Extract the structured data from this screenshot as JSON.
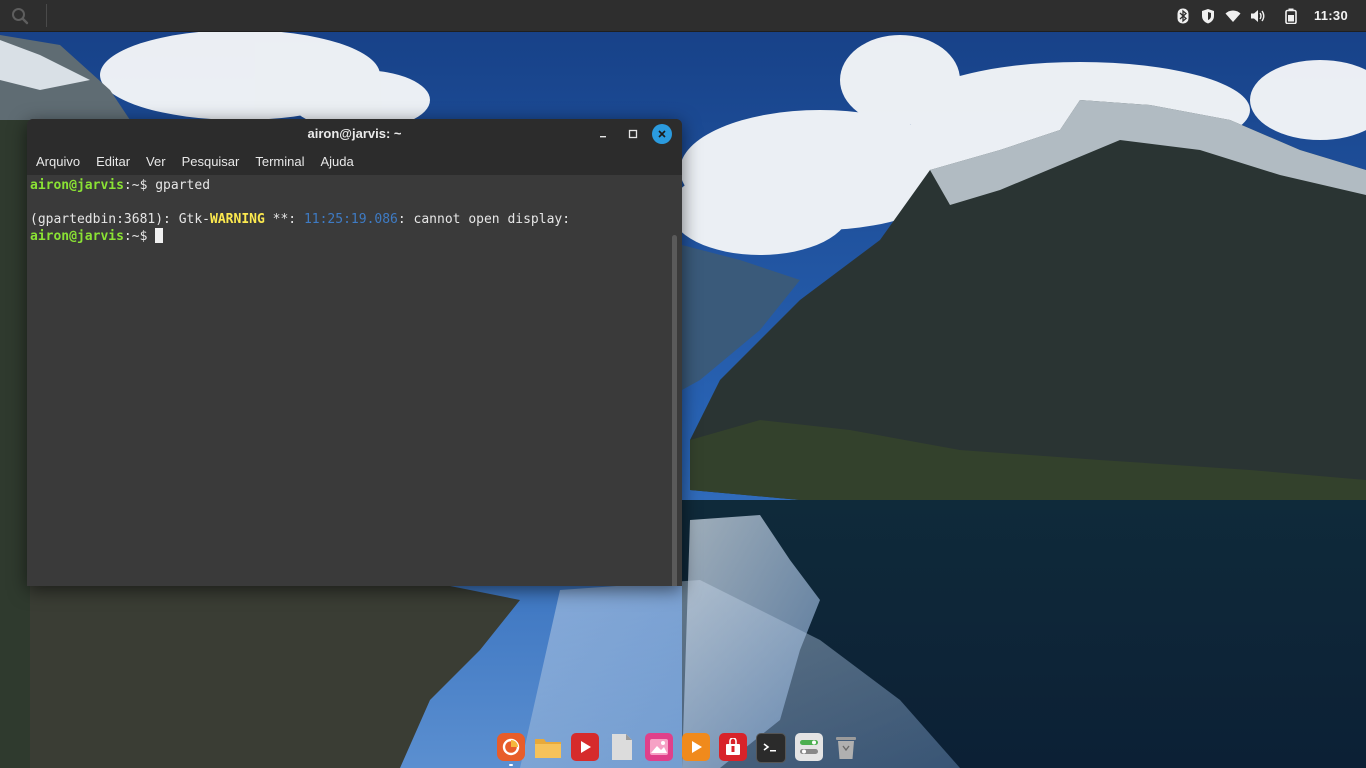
{
  "panel": {
    "clock": "11:30",
    "search_icon": "search-icon",
    "tray_icons": [
      "bluetooth-icon",
      "shield-icon",
      "wifi-icon",
      "volume-icon",
      "battery-icon"
    ]
  },
  "terminal": {
    "title": "airon@jarvis: ~",
    "menu": [
      "Arquivo",
      "Editar",
      "Ver",
      "Pesquisar",
      "Terminal",
      "Ajuda"
    ],
    "lines": {
      "l1_user": "airon@jarvis",
      "l1_path": ":~$ ",
      "l1_cmd": "gparted",
      "l2_a": "(gpartedbin:3681): Gtk-",
      "l2_warn": "WARNING",
      "l2_b": " **: ",
      "l2_time": "11:25:19.086",
      "l2_c": ": cannot open display: ",
      "l3_user": "airon@jarvis",
      "l3_path": ":~$ "
    },
    "colors": {
      "prompt": "#8ae234",
      "warning": "#fce94f",
      "timestamp": "#3e7bc4",
      "close_button": "#2b9bdf"
    }
  },
  "dock": {
    "items": [
      "firefox-icon",
      "files-icon",
      "video-player-icon",
      "text-editor-icon",
      "image-viewer-icon",
      "media-player-icon",
      "software-center-icon",
      "terminal-icon",
      "settings-icon",
      "trash-icon"
    ]
  }
}
